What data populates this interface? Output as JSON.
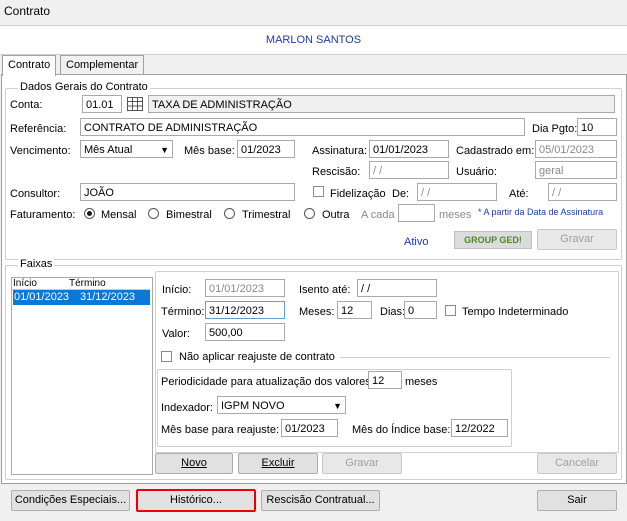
{
  "window_title": "Contrato",
  "header_name": "MARLON SANTOS",
  "tabs": [
    "Contrato",
    "Complementar"
  ],
  "dados": {
    "title": "Dados Gerais do Contrato",
    "conta_label": "Conta:",
    "conta_value": "01.01",
    "conta_desc": "TAXA DE ADMINISTRAÇÃO",
    "referencia_label": "Referência:",
    "referencia_value": "CONTRATO DE ADMINISTRAÇÃO",
    "dia_pgto_label": "Dia Pgto:",
    "dia_pgto_value": "10",
    "vencimento_label": "Vencimento:",
    "vencimento_value": "Mês Atual",
    "mes_base_label": "Mês base:",
    "mes_base_value": "01/2023",
    "assinatura_label": "Assinatura:",
    "assinatura_value": "01/01/2023",
    "cadastrado_label": "Cadastrado em:",
    "cadastrado_value": "05/01/2023",
    "rescisao_label": "Rescisão:",
    "rescisao_value": "/ /",
    "usuario_label": "Usuário:",
    "usuario_value": "geral",
    "consultor_label": "Consultor:",
    "consultor_value": "JOÃO",
    "fidelizacao_label": "Fidelização",
    "de_label": "De:",
    "de_value": "/ /",
    "ate_label": "Até:",
    "ate_value": "/ /",
    "faturamento_label": "Faturamento:",
    "faturamento_options": [
      "Mensal",
      "Bimestral",
      "Trimestral",
      "Outra"
    ],
    "faturamento_selected": "Mensal",
    "a_cada_label": "A cada",
    "meses_label": "meses",
    "assinatura_note": "* A partir da Data de Assinatura",
    "status": "Ativo",
    "ged_logo": "GROUP GED!",
    "gravar_label": "Gravar"
  },
  "faixas": {
    "title": "Faixas",
    "columns": [
      "Início",
      "Término"
    ],
    "rows": [
      [
        "01/01/2023",
        "31/12/2023"
      ]
    ],
    "inicio_label": "Início:",
    "inicio_value": "01/01/2023",
    "isento_label": "Isento até:",
    "isento_value": "/ /",
    "termino_label": "Término:",
    "termino_value": "31/12/2023",
    "meses_label": "Meses:",
    "meses_value": "12",
    "dias_label": "Dias:",
    "dias_value": "0",
    "tempo_label": "Tempo Indeterminado",
    "valor_label": "Valor:",
    "valor_value": "500,00",
    "nao_aplicar_label": "Não aplicar reajuste de contrato",
    "periodicidade_label": "Periodicidade para atualização dos valores:",
    "periodicidade_value": "12",
    "periodicidade_unit": "meses",
    "indexador_label": "Indexador:",
    "indexador_value": "IGPM NOVO",
    "mes_base_reajuste_label": "Mês base para reajuste:",
    "mes_base_reajuste_value": "01/2023",
    "mes_indice_label": "Mês do Índice base:",
    "mes_indice_value": "12/2022",
    "novo_label": "Novo",
    "excluir_label": "Excluir",
    "gravar_label": "Gravar",
    "cancelar_label": "Cancelar"
  },
  "footer": {
    "condicoes_label": "Condições Especiais...",
    "historico_label": "Histórico...",
    "rescisao_label": "Rescisão Contratual...",
    "sair_label": "Sair",
    "highlight_color": "#e00000"
  },
  "colors": {
    "header_text": "#1a3c9e",
    "status_text": "#1a3c9e",
    "selection": "#0a78d7"
  }
}
